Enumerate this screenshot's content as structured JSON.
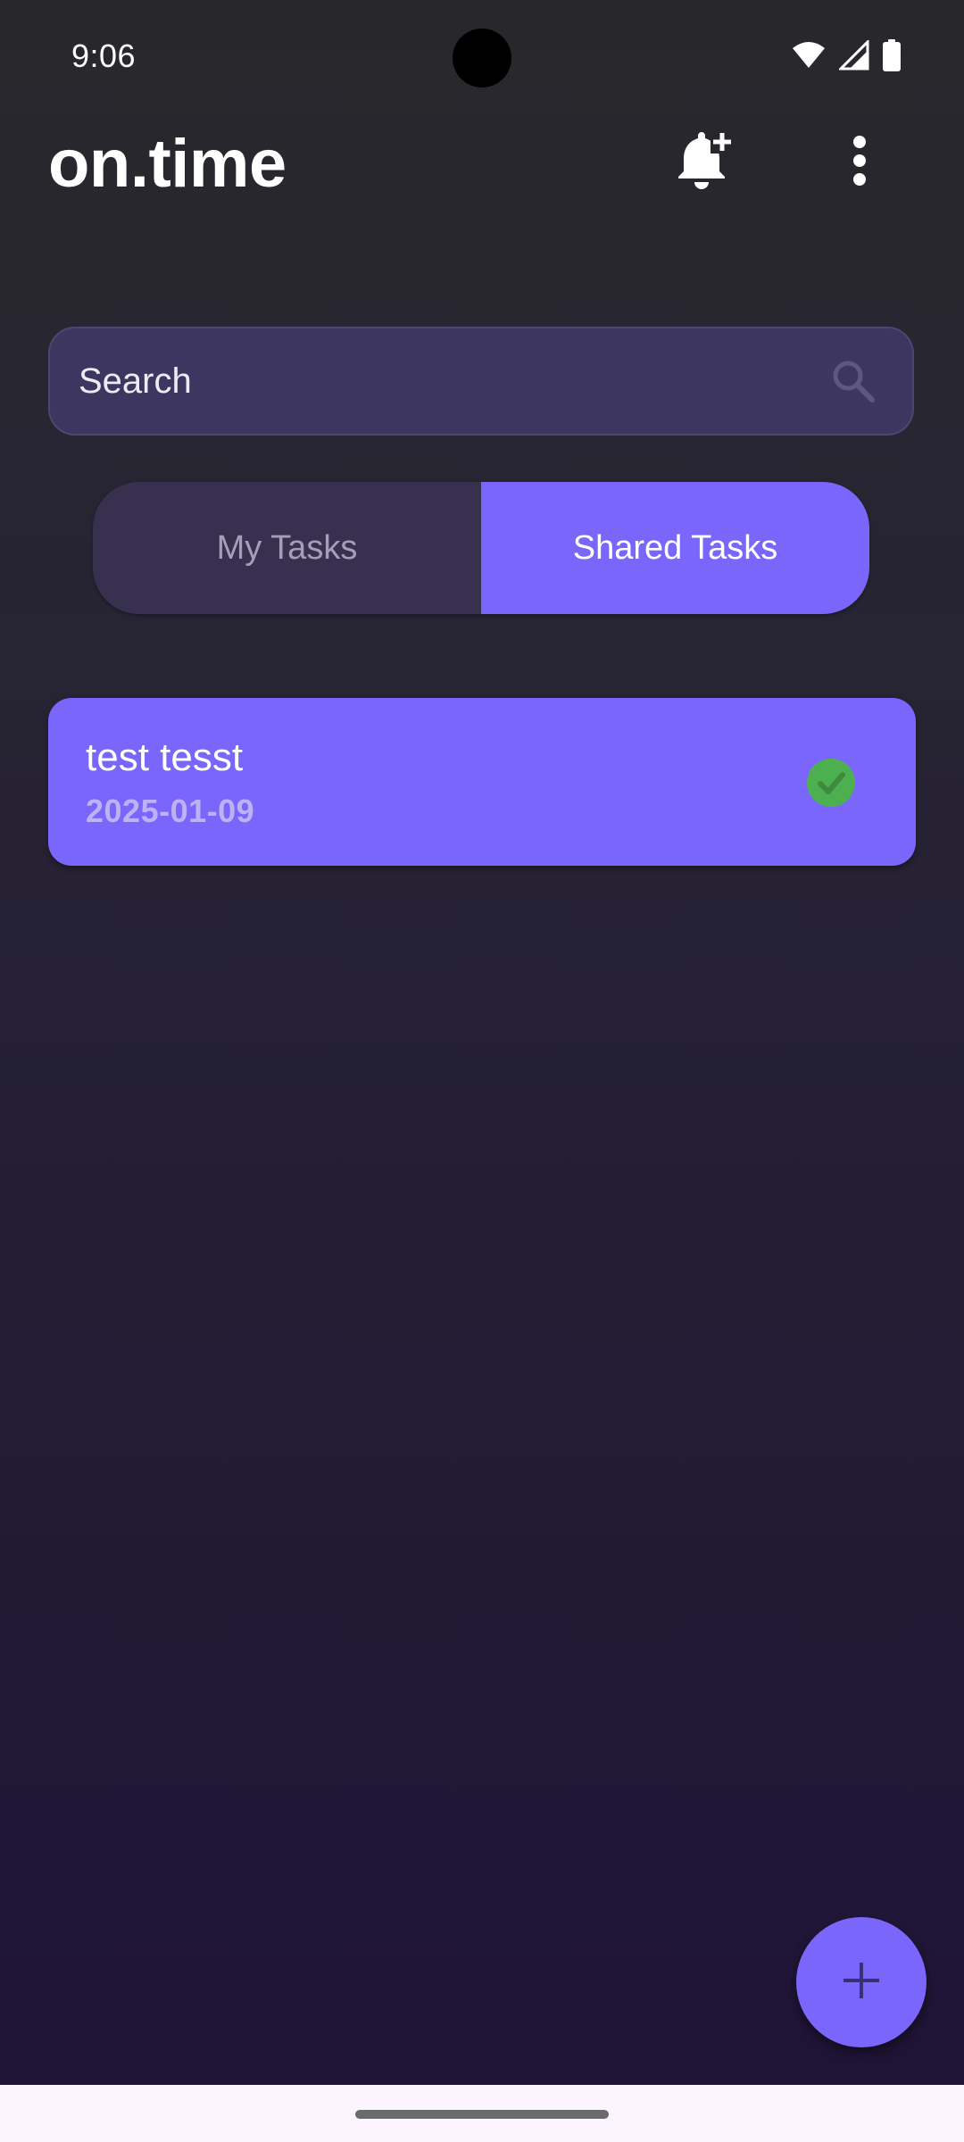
{
  "status_bar": {
    "time": "9:06",
    "icons": [
      "wifi-icon",
      "cell-signal-icon",
      "battery-icon"
    ]
  },
  "app_bar": {
    "title": "on.time",
    "actions": [
      "add-alarm-bell-icon",
      "more-vert-icon"
    ]
  },
  "search": {
    "placeholder": "Search",
    "value": "",
    "icon": "search-icon"
  },
  "tabs": [
    {
      "label": "My Tasks",
      "selected": false
    },
    {
      "label": "Shared Tasks",
      "selected": true
    }
  ],
  "tasks": [
    {
      "title": "test tesst",
      "date": "2025-01-09",
      "completed": true,
      "status_icon": "check-circle-icon"
    }
  ],
  "fab": {
    "icon": "plus-icon"
  },
  "colors": {
    "accent": "#7b66fc",
    "background_top": "#28282c",
    "background_bottom": "#1f1336",
    "search_bg": "#3c3660",
    "inactive_tab_bg": "#37304f",
    "check_green": "#4caf50",
    "fab_icon": "#3a2f77"
  }
}
